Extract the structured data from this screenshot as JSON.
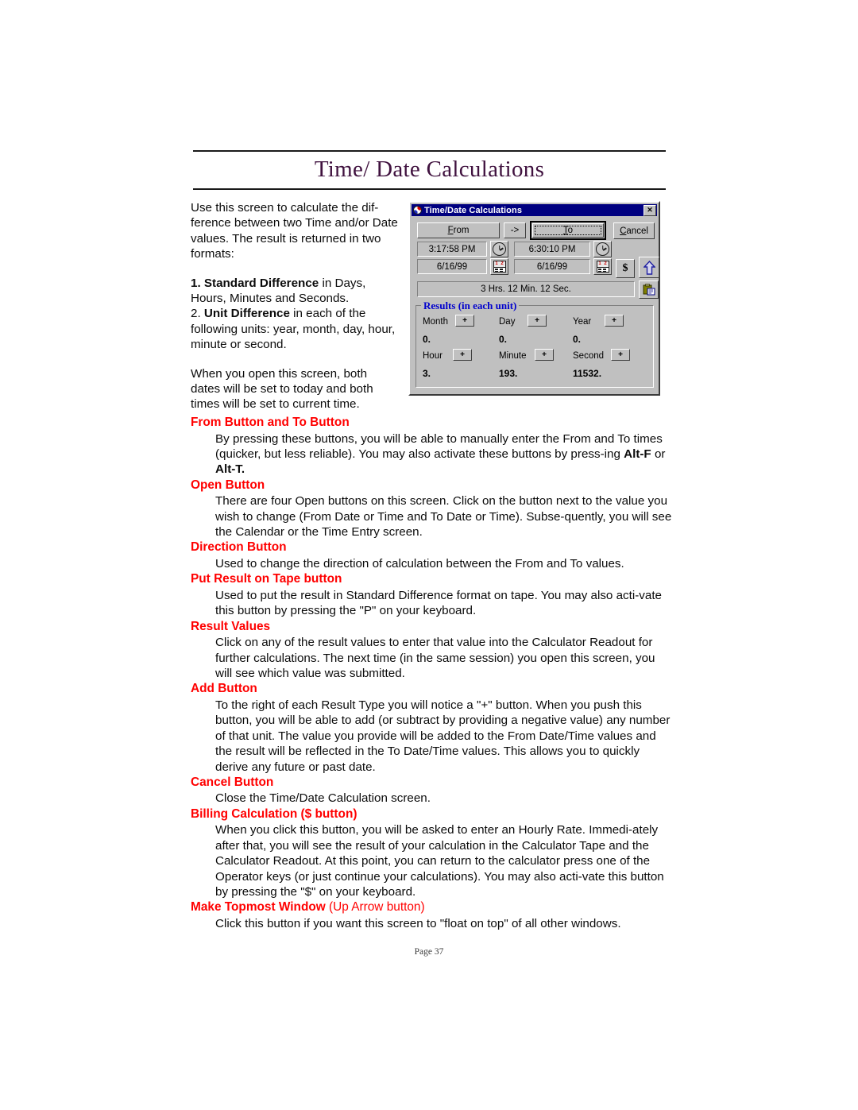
{
  "document": {
    "title": "Time/ Date Calculations",
    "footer": "Page 37"
  },
  "intro": {
    "p1": "Use this screen to calculate the dif-ference between two Time and/or Date values.  The result is returned in two formats:",
    "item1_bold": "1. Standard Difference",
    "item1_rest": " in Days, Hours, Minutes and Seconds.",
    "item2_num": "2. ",
    "item2_bold": "Unit Difference",
    "item2_rest": " in each of the following units: year, month, day, hour, minute or second.",
    "p2": "When you open this screen, both dates will be set to today and both times will be set to current time."
  },
  "dialog": {
    "titlebar": {
      "title": "Time/Date Calculations",
      "close_label": "✕",
      "bg_color": "#000080"
    },
    "from_button": {
      "label": "From",
      "accel": "F"
    },
    "direction_button": {
      "label": "->"
    },
    "to_button": {
      "label": "To",
      "accel": "T"
    },
    "cancel_button": {
      "label": "Cancel",
      "accel": "C"
    },
    "from_time": "3:17:58 PM",
    "from_date": "6/16/99",
    "to_time": "6:30:10 PM",
    "to_date": "6/16/99",
    "dollar_button": {
      "label": "$"
    },
    "topmost_button": {
      "icon": "up-arrow-icon"
    },
    "tape_button": {
      "icon": "put-on-tape-icon"
    },
    "standard_result": "3 Hrs. 12 Min. 12 Sec.",
    "results_group": {
      "legend": "Results (in each unit)",
      "legend_color": "#0000cd",
      "add_label": "+",
      "units": [
        {
          "label": "Month",
          "value": "0."
        },
        {
          "label": "Day",
          "value": "0."
        },
        {
          "label": "Year",
          "value": "0."
        },
        {
          "label": "Hour",
          "value": "3."
        },
        {
          "label": "Minute",
          "value": "193."
        },
        {
          "label": "Second",
          "value": "11532."
        }
      ]
    },
    "calendar_icon_digits": [
      "1",
      "2"
    ]
  },
  "sections": [
    {
      "heading": "From Button and To Button",
      "heading_suffix": "",
      "body_pre": "By pressing these buttons, you will be able to manually enter the From and To times (quicker, but less reliable).  You may also activate these buttons by press-ing ",
      "bold1": "Alt-F",
      "body_mid": " or ",
      "bold2": "Alt-T.",
      "body_post": ""
    },
    {
      "heading": "Open Button",
      "heading_suffix": "",
      "body": "There are four Open buttons on this screen.  Click on the button next to the value you wish to change (From Date or Time and To Date or Time).  Subse-quently, you will see the Calendar or the Time Entry screen."
    },
    {
      "heading": "Direction Button",
      "heading_suffix": "",
      "body": "Used to change the direction of calculation between the From and To values."
    },
    {
      "heading": "Put Result on Tape button",
      "heading_suffix": "",
      "body": "Used to put the result in Standard Difference format on tape.  You may also acti-vate this button by pressing the \"P\" on your keyboard."
    },
    {
      "heading": "Result Values",
      "heading_suffix": "",
      "body": "Click on any of the result values to enter that value into the Calculator Readout for further calculations.  The next time (in the same session) you open this screen, you will see which value was submitted."
    },
    {
      "heading": "Add Button",
      "heading_suffix": "",
      "body": "To the right of each Result Type you will notice a \"+\" button.  When you push this button, you will be able to add (or subtract by providing a negative value) any number of that unit.  The value you provide will be added to the From Date/Time values and the result will be reflected in the To Date/Time values.  This allows you to quickly derive any future or past date."
    },
    {
      "heading": "Cancel Button",
      "heading_suffix": "",
      "body": "Close the Time/Date Calculation screen."
    },
    {
      "heading": "Billing Calculation ($ button)",
      "heading_suffix": "",
      "body": "When you click this button, you will be asked to enter an Hourly Rate.  Immedi-ately after that, you will see the result of your calculation in the Calculator Tape and the Calculator Readout.  At this point, you can return to the calculator press one of the Operator keys (or just continue your calculations).  You may also acti-vate this button by pressing the \"$\" on your keyboard."
    },
    {
      "heading": "Make Topmost Window",
      "heading_suffix": " (Up Arrow button)",
      "body": "Click this button if you want this screen to \"float on top\" of all other windows."
    }
  ]
}
